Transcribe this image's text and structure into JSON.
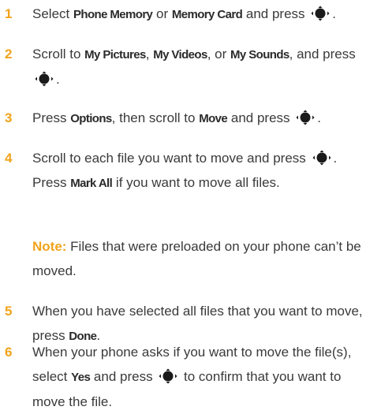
{
  "icons": {
    "nav_key": "center-select-key-icon"
  },
  "colors": {
    "step_number": "#f2a31b",
    "body_text": "#3a3a3a",
    "note_label": "#f2a31b"
  },
  "steps": [
    {
      "number": "1",
      "t1": "Select ",
      "term1": "Phone Memory",
      "t2": " or ",
      "term2": "Memory Card",
      "t3": " and press ",
      "t4": "."
    },
    {
      "number": "2",
      "t1": "Scroll to ",
      "term1": "My Pictures",
      "t2": ", ",
      "term2": "My Videos",
      "t3": ", or ",
      "term3": "My Sounds",
      "t4": ", and press ",
      "t5": "."
    },
    {
      "number": "3",
      "t1": "Press ",
      "term1": "Options",
      "t2": ", then scroll to ",
      "term2": "Move",
      "t3": " and press ",
      "t4": "."
    },
    {
      "number": "4",
      "t1": "Scroll to each file you want to move and press ",
      "t2": ". Press ",
      "term1": "Mark All",
      "t3": " if you want to move all files."
    },
    {
      "number": "5",
      "t1": "When you have selected all files that you want to move, press ",
      "term1": "Done",
      "t2": "."
    },
    {
      "number": "6",
      "t1": "When your phone asks if you want to move the file(s), select ",
      "term1": "Yes",
      "t2": " and press ",
      "t3": " to confirm that you want to move the file."
    }
  ],
  "note": {
    "label": "Note:",
    "text": " Files that were preloaded on your phone can’t be moved."
  }
}
